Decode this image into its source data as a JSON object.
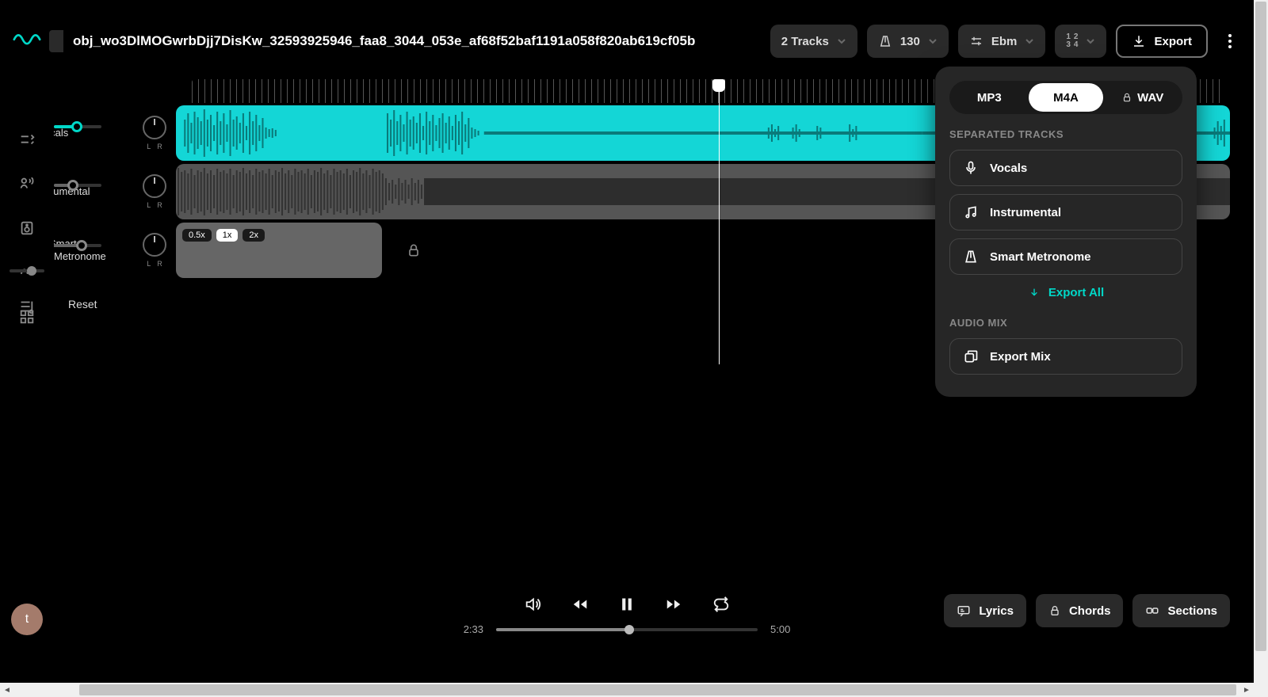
{
  "project_title": "obj_wo3DlMOGwrbDjj7DisKw_32593925946_faa8_3044_053e_af68f52baf1191a058f820ab619cf05b",
  "topbar": {
    "tracks_label": "2 Tracks",
    "tempo": "130",
    "key": "Ebm",
    "count_in": [
      "1",
      "2",
      "3",
      "4"
    ],
    "export": "Export"
  },
  "tracks": [
    {
      "name": "Vocals",
      "color": "#14d6d6",
      "vol_pct": 48
    },
    {
      "name": "Instrumental",
      "color": "#555",
      "vol_pct": 40
    },
    {
      "name": "Smart Metronome",
      "color": "#666",
      "vol_pct": 58
    }
  ],
  "speed_chips": [
    "0.5x",
    "1x",
    "2x"
  ],
  "speed_active": "1x",
  "reset": "Reset",
  "export_panel": {
    "formats": [
      "MP3",
      "M4A",
      "WAV"
    ],
    "format_active": "M4A",
    "sec_separated": "SEPARATED TRACKS",
    "items": [
      "Vocals",
      "Instrumental",
      "Smart Metronome"
    ],
    "export_all": "Export All",
    "sec_mix": "AUDIO MIX",
    "mix": "Export Mix"
  },
  "player": {
    "current": "2:33",
    "total": "5:00",
    "progress_pct": 51
  },
  "playhead_pct": 51,
  "bottom_actions": {
    "lyrics": "Lyrics",
    "chords": "Chords",
    "sections": "Sections"
  },
  "avatar": "t"
}
